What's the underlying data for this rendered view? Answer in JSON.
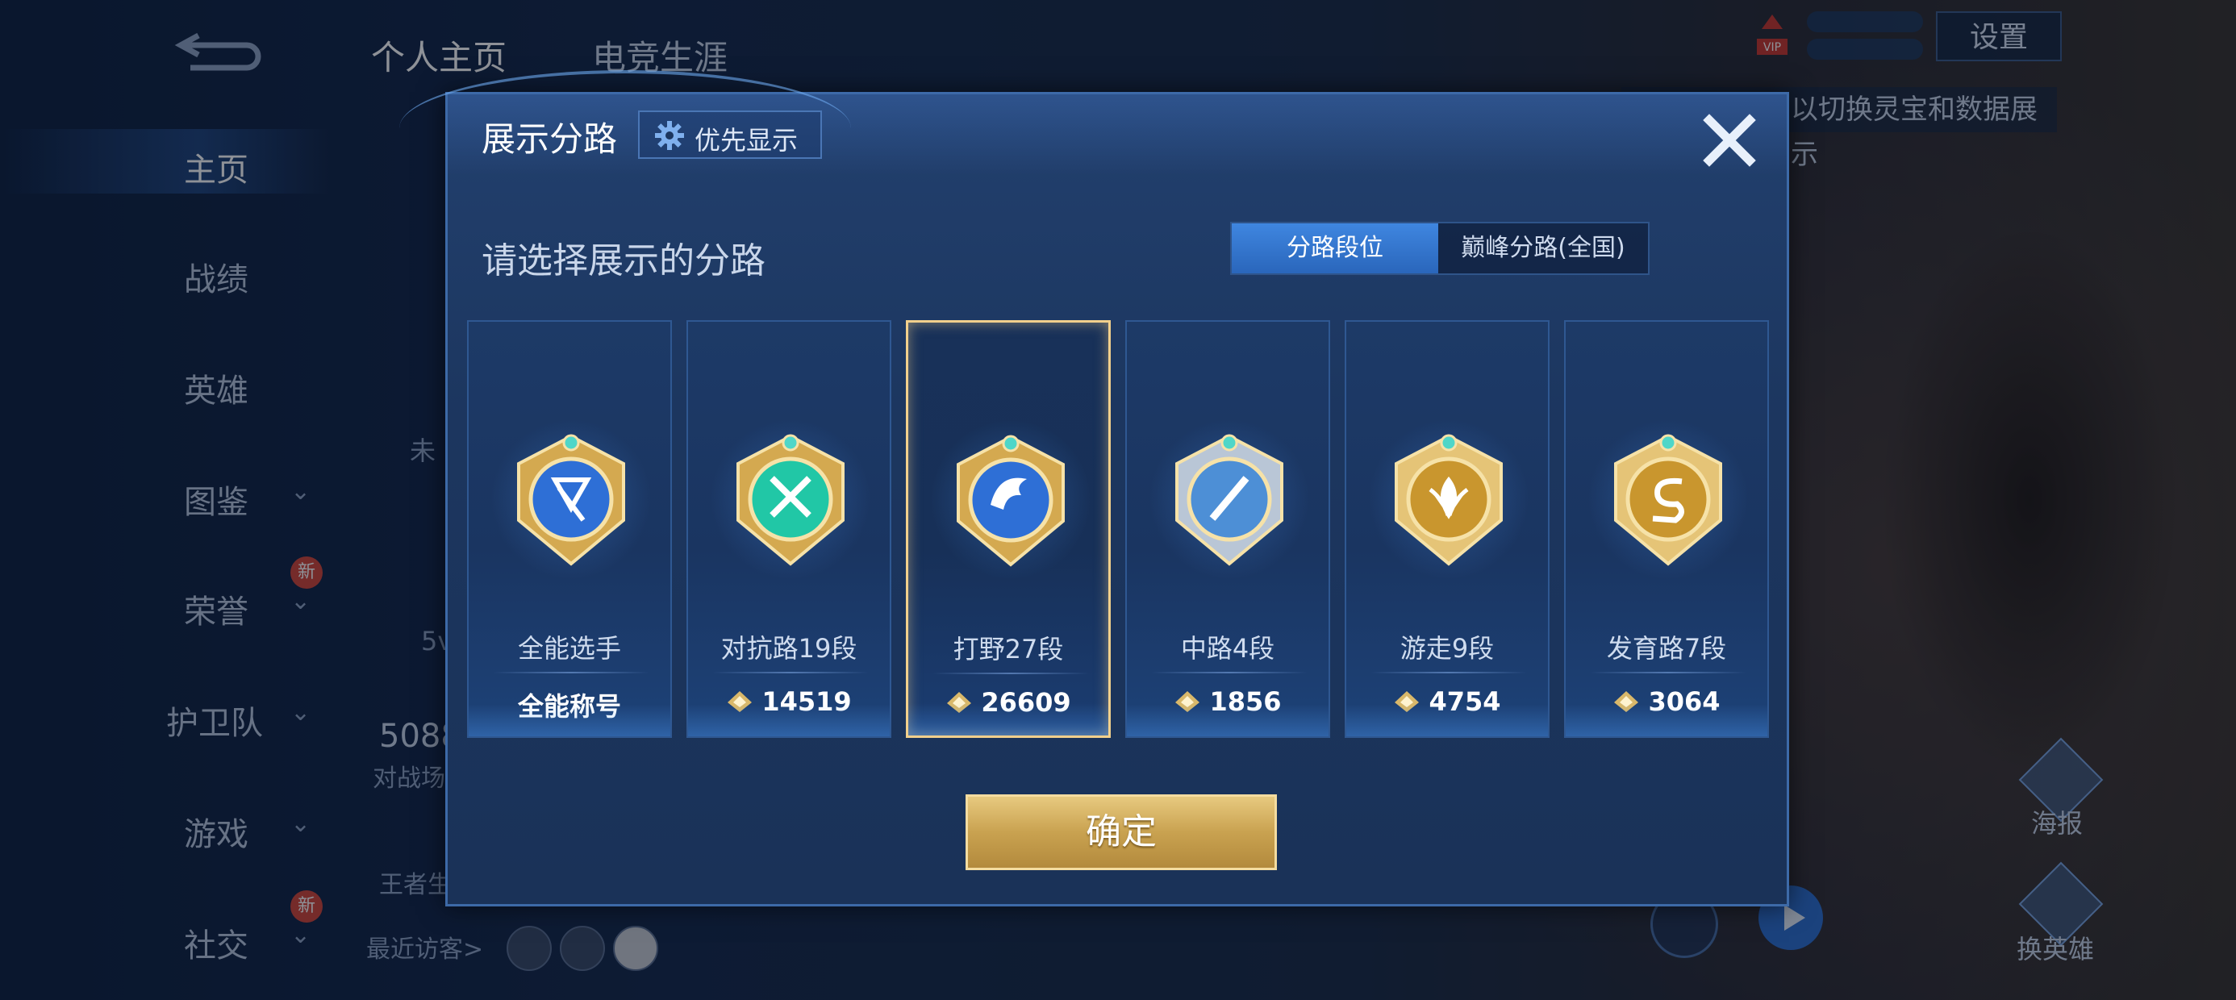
{
  "background": {
    "tabs": [
      "个人主页",
      "电竞生涯"
    ],
    "sidebar": [
      {
        "label": "主页",
        "chevron": false,
        "new": false,
        "active": true
      },
      {
        "label": "战绩",
        "chevron": false,
        "new": false,
        "active": false
      },
      {
        "label": "英雄",
        "chevron": false,
        "new": false,
        "active": false
      },
      {
        "label": "图鉴",
        "chevron": true,
        "new": false,
        "active": false
      },
      {
        "label": "荣誉",
        "chevron": true,
        "new": true,
        "active": false
      },
      {
        "label": "护卫队",
        "chevron": true,
        "new": false,
        "active": false
      },
      {
        "label": "游戏",
        "chevron": true,
        "new": false,
        "active": false
      },
      {
        "label": "社交",
        "chevron": true,
        "new": true,
        "active": false
      }
    ],
    "new_badge": "新",
    "recent_visitors": "最近访客>",
    "settings": "设置",
    "hint": "以切换灵宝和数据展示",
    "right_buttons": [
      "海报",
      "换英雄"
    ],
    "partial_texts": [
      "未",
      "5v",
      "5088",
      "对战场",
      "王者生"
    ]
  },
  "modal": {
    "title": "展示分路",
    "priority_label": "优先显示",
    "subtitle": "请选择展示的分路",
    "tabs": [
      {
        "label": "分路段位",
        "active": true
      },
      {
        "label": "巅峰分路(全国)",
        "active": false
      }
    ],
    "cards": [
      {
        "name": "全能选手",
        "score": "全能称号",
        "has_icon": false,
        "selected": false,
        "badge": "all-round",
        "colors": [
          "#2e6fd6",
          "#d4a950"
        ]
      },
      {
        "name": "对抗路19段",
        "score": "14519",
        "has_icon": true,
        "selected": false,
        "badge": "clash-lane",
        "colors": [
          "#21c7a6",
          "#d4a950"
        ]
      },
      {
        "name": "打野27段",
        "score": "26609",
        "has_icon": true,
        "selected": true,
        "badge": "jungle",
        "colors": [
          "#2e6fd6",
          "#d4a950"
        ]
      },
      {
        "name": "中路4段",
        "score": "1856",
        "has_icon": true,
        "selected": false,
        "badge": "mid-lane",
        "colors": [
          "#4d8fd6",
          "#b9c6d6"
        ]
      },
      {
        "name": "游走9段",
        "score": "4754",
        "has_icon": true,
        "selected": false,
        "badge": "roam",
        "colors": [
          "#c9962e",
          "#e5c477"
        ]
      },
      {
        "name": "发育路7段",
        "score": "3064",
        "has_icon": true,
        "selected": false,
        "badge": "farm-lane",
        "colors": [
          "#c9962e",
          "#e5c477"
        ]
      }
    ],
    "confirm": "确定"
  },
  "colors": {
    "accent_gold": "#f2d08c",
    "tab_active": "#3f86e0",
    "modal_bg": "#1c365f"
  }
}
